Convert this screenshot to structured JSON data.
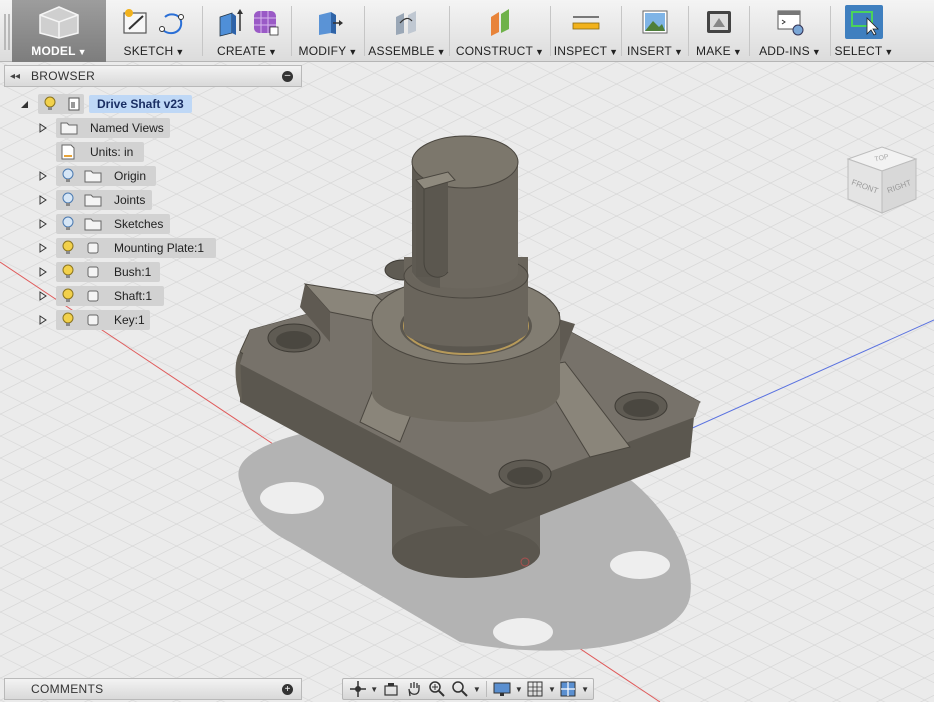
{
  "toolbar": {
    "groups": [
      {
        "label": "MODEL"
      },
      {
        "label": "SKETCH"
      },
      {
        "label": "CREATE"
      },
      {
        "label": "MODIFY"
      },
      {
        "label": "ASSEMBLE"
      },
      {
        "label": "CONSTRUCT"
      },
      {
        "label": "INSPECT"
      },
      {
        "label": "INSERT"
      },
      {
        "label": "MAKE"
      },
      {
        "label": "ADD-INS"
      },
      {
        "label": "SELECT"
      }
    ]
  },
  "browser": {
    "title": "BROWSER",
    "root": {
      "label": "Drive Shaft v23"
    },
    "items": [
      {
        "label": "Named Views",
        "icon": "folder-icon"
      },
      {
        "label": "Units: in",
        "icon": "document-icon"
      },
      {
        "label": "Origin",
        "icon": "folder-icon"
      },
      {
        "label": "Joints",
        "icon": "folder-icon"
      },
      {
        "label": "Sketches",
        "icon": "folder-icon"
      },
      {
        "label": "Mounting Plate:1",
        "icon": "component-icon"
      },
      {
        "label": "Bush:1",
        "icon": "component-icon"
      },
      {
        "label": "Shaft:1",
        "icon": "component-icon"
      },
      {
        "label": "Key:1",
        "icon": "component-icon"
      }
    ]
  },
  "comments": {
    "title": "COMMENTS"
  },
  "viewcube": {
    "top": "TOP",
    "front": "FRONT",
    "right": "RIGHT"
  },
  "colors": {
    "model_body": "#6f6a60",
    "selection_blue": "#3f7fbf",
    "highlight": "#bfd8f6"
  }
}
